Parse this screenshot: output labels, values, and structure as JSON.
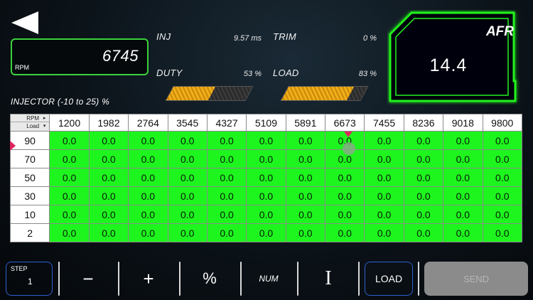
{
  "header": {
    "back_icon": "back-arrow-icon"
  },
  "rpm": {
    "value": "6745",
    "label": "RPM"
  },
  "stats": {
    "inj_label": "INJ",
    "inj_value": "9.57 ms",
    "trim_label": "TRIM",
    "trim_value": "0 %",
    "duty_label": "DUTY",
    "duty_value": "53 %",
    "duty_fraction": 0.53,
    "load_label": "LOAD",
    "load_value": "83 %",
    "load_fraction": 0.83
  },
  "afr": {
    "label": "AFR",
    "value": "14.4",
    "accent": "#23f21f"
  },
  "table": {
    "title": "INJECTOR (-10 to 25) %",
    "corner_rpm": "RPM",
    "corner_load": "Load",
    "rpm_columns": [
      "1200",
      "1982",
      "2764",
      "3545",
      "4327",
      "5109",
      "5891",
      "6673",
      "7455",
      "8236",
      "9018",
      "9800"
    ],
    "load_rows": [
      "90",
      "70",
      "50",
      "30",
      "10",
      "2"
    ],
    "cells": [
      [
        "0.0",
        "0.0",
        "0.0",
        "0.0",
        "0.0",
        "0.0",
        "0.0",
        "0.0",
        "0.0",
        "0.0",
        "0.0",
        "0.0"
      ],
      [
        "0.0",
        "0.0",
        "0.0",
        "0.0",
        "0.0",
        "0.0",
        "0.0",
        "0.0",
        "0.0",
        "0.0",
        "0.0",
        "0.0"
      ],
      [
        "0.0",
        "0.0",
        "0.0",
        "0.0",
        "0.0",
        "0.0",
        "0.0",
        "0.0",
        "0.0",
        "0.0",
        "0.0",
        "0.0"
      ],
      [
        "0.0",
        "0.0",
        "0.0",
        "0.0",
        "0.0",
        "0.0",
        "0.0",
        "0.0",
        "0.0",
        "0.0",
        "0.0",
        "0.0"
      ],
      [
        "0.0",
        "0.0",
        "0.0",
        "0.0",
        "0.0",
        "0.0",
        "0.0",
        "0.0",
        "0.0",
        "0.0",
        "0.0",
        "0.0"
      ],
      [
        "0.0",
        "0.0",
        "0.0",
        "0.0",
        "0.0",
        "0.0",
        "0.0",
        "0.0",
        "0.0",
        "0.0",
        "0.0",
        "0.0"
      ]
    ],
    "cell_color": "#1ef51e"
  },
  "toolbar": {
    "step_label": "STEP",
    "step_value": "1",
    "minus_label": "−",
    "plus_label": "+",
    "percent_label": "%",
    "num_label": "NUM",
    "cursor_label": "I",
    "load_label": "LOAD",
    "send_label": "SEND",
    "accent": "#2f5fd3"
  }
}
